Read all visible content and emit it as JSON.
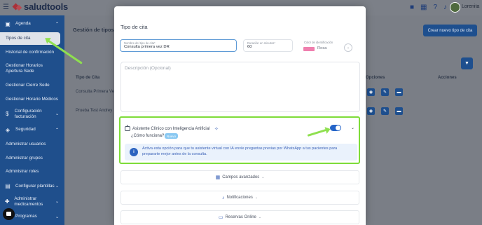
{
  "app": {
    "brand": "saludtools",
    "user": "Lorenita"
  },
  "topbar": {
    "icons": [
      "video-icon",
      "calendar-icon",
      "help-icon",
      "bell-icon"
    ]
  },
  "sidebar": {
    "agenda": "Agenda",
    "tipos_cita": "Tipos de cita",
    "historial": "Historial de confirmación",
    "horarios": "Gestionar Horarios Apertura Sede",
    "cierre": "Gestionar Cierre Sede",
    "horario_medicos": "Gestionar Horario Médicos",
    "facturacion": "Configuración facturación",
    "seguridad": "Seguridad",
    "usuarios": "Administrar usuarios",
    "grupos": "Administrar grupos",
    "roles": "Administrar roles",
    "plantillas": "Configurar plantillas",
    "medicamentos": "Administrar medicamentos",
    "programas": "Programas"
  },
  "page": {
    "title": "Gestión de tipos d",
    "new_button": "Crear nuevo tipo de cita",
    "col_type": "Tipo de Cita",
    "col_options": "Opciones",
    "col_actions": "Acciones",
    "rows": [
      "Consulta Primera Ve",
      "Prueba Test Andrey"
    ]
  },
  "modal": {
    "title": "Tipo de cita",
    "name_label": "Nombre del tipo de cita*",
    "name_value": "Consulta primera vez DR",
    "duration_label": "Duración en minutos*",
    "duration_value": "60",
    "color_label": "Color de identificación",
    "color_value": "Rosa",
    "color_hex": "#ef7fae",
    "description_placeholder": "Descripción (Opcional)",
    "ai": {
      "title": "Asistente Clínico con Inteligencia Artificial",
      "how_link": "¿Cómo funciona?",
      "badge": "Nuevo",
      "toggle_on": true,
      "info": "Activa esta opción para que tu asistente virtual con IA envíe preguntas previas por WhatsApp a tus pacientes para prepararte mejor antes de la consulta."
    },
    "sections": {
      "campos": "Campos avanzados",
      "notificaciones": "Notificaciones",
      "reservas": "Reservas Online"
    }
  },
  "colors": {
    "sidebar": "#1f4f8c",
    "accent": "#2464c8",
    "highlight": "#7edc39"
  }
}
